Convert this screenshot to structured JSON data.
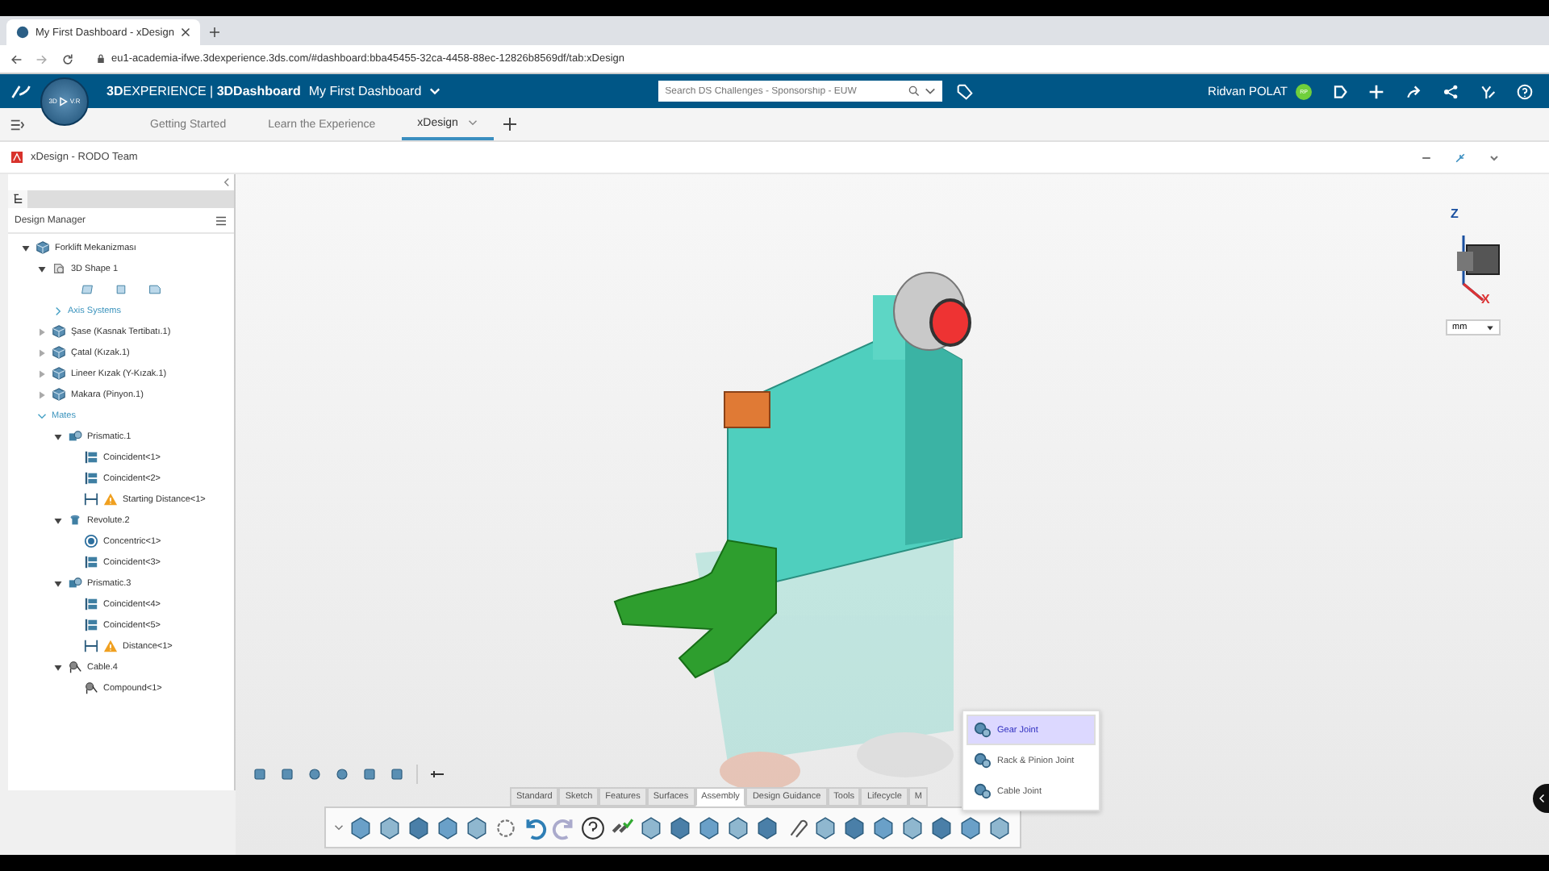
{
  "browser": {
    "tab_title": "My First Dashboard - xDesign",
    "url": "eu1-academia-ifwe.3dexperience.3ds.com/#dashboard:bba45455-32ca-4458-88ec-12826b8569df/tab:xDesign"
  },
  "header": {
    "compass_labels": [
      "3D",
      "V.R"
    ],
    "brand": "**3D**EXPERIENCE | **3DDashboard**",
    "dashboard": "My First Dashboard",
    "search": {
      "placeholder": "Search DS Challenges - Sponsorship - EUW"
    },
    "user": "Ridvan POLAT",
    "avatar": "RP"
  },
  "dashboard_tabs": [
    {
      "label": "Getting Started",
      "selected": false
    },
    {
      "label": "Learn the Experience",
      "selected": false
    },
    {
      "label": "xDesign",
      "selected": true
    }
  ],
  "app": {
    "title": "xDesign - RODO Team"
  },
  "design_manager": {
    "title": "Design Manager",
    "tree": [
      {
        "label": "Forklift Mekanizması",
        "kind": "assembly",
        "expanded": true,
        "children": [
          {
            "label": "3D Shape 1",
            "kind": "shape",
            "expanded": true,
            "children": [
              {
                "kind": "planes"
              },
              {
                "label": "Axis Systems",
                "kind": "folder",
                "expanded": false
              }
            ]
          },
          {
            "label": "Şase (Kasnak Tertibatı.1)",
            "kind": "part",
            "expanded": false
          },
          {
            "label": "Çatal (Kızak.1)",
            "kind": "part",
            "expanded": false
          },
          {
            "label": "Lineer Kızak (Y-Kızak.1)",
            "kind": "part",
            "expanded": false
          },
          {
            "label": "Makara (Pinyon.1)",
            "kind": "part",
            "expanded": false
          },
          {
            "label": "Mates",
            "kind": "folder",
            "expanded": true,
            "children": [
              {
                "label": "Prismatic.1",
                "kind": "prismatic",
                "expanded": true,
                "children": [
                  {
                    "label": "Coincident<1>",
                    "kind": "coincident",
                    "warning": false
                  },
                  {
                    "label": "Coincident<2>",
                    "kind": "coincident",
                    "warning": false
                  },
                  {
                    "label": "Starting Distance<1>",
                    "kind": "distance",
                    "warning": true
                  }
                ]
              },
              {
                "label": "Revolute.2",
                "kind": "revolute",
                "expanded": true,
                "children": [
                  {
                    "label": "Concentric<1>",
                    "kind": "concentric",
                    "warning": false
                  },
                  {
                    "label": "Coincident<3>",
                    "kind": "coincident",
                    "warning": false
                  }
                ]
              },
              {
                "label": "Prismatic.3",
                "kind": "prismatic",
                "expanded": true,
                "children": [
                  {
                    "label": "Coincident<4>",
                    "kind": "coincident",
                    "warning": false
                  },
                  {
                    "label": "Coincident<5>",
                    "kind": "coincident",
                    "warning": false
                  },
                  {
                    "label": "Distance<1>",
                    "kind": "distance",
                    "warning": true
                  }
                ]
              },
              {
                "label": "Cable.4",
                "kind": "cable",
                "expanded": true,
                "children": [
                  {
                    "label": "Compound<1>",
                    "kind": "cable",
                    "warning": false
                  }
                ]
              }
            ]
          }
        ]
      }
    ]
  },
  "viewport": {
    "axes": [
      "Z",
      "X"
    ],
    "unit": "mm"
  },
  "action_tabs": [
    {
      "label": "Standard",
      "selected": false
    },
    {
      "label": "Sketch",
      "selected": false
    },
    {
      "label": "Features",
      "selected": false
    },
    {
      "label": "Surfaces",
      "selected": false
    },
    {
      "label": "Assembly",
      "selected": true
    },
    {
      "label": "Design Guidance",
      "selected": false
    },
    {
      "label": "Tools",
      "selected": false
    },
    {
      "label": "Lifecycle",
      "selected": false
    },
    {
      "label": "M",
      "selected": false
    }
  ],
  "joint_menu": [
    {
      "label": "Gear Joint",
      "selected": true
    },
    {
      "label": "Rack & Pinion Joint",
      "selected": false
    },
    {
      "label": "Cable Joint",
      "selected": false
    }
  ]
}
